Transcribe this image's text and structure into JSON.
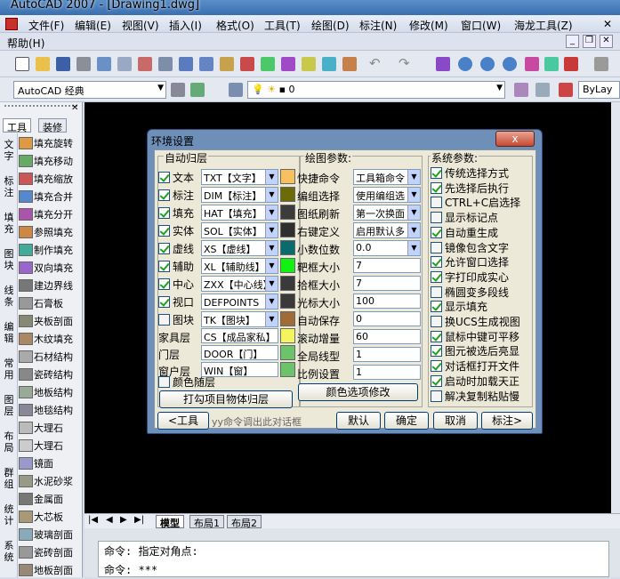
{
  "window": {
    "title_app": "AutoCAD 2007 - ",
    "title_doc": "[Drawing1.dwg]"
  },
  "menu": [
    "文件(F)",
    "编辑(E)",
    "视图(V)",
    "插入(I)",
    "格式(O)",
    "工具(T)",
    "绘图(D)",
    "标注(N)",
    "修改(M)",
    "窗口(W)",
    "海龙工具(Z)"
  ],
  "menu2": [
    "帮助(H)"
  ],
  "toolbar": {
    "workspace": "AutoCAD 经典",
    "layer_value": "0",
    "bylayer": "ByLay"
  },
  "palette": {
    "tabs": [
      "工具",
      "装修"
    ],
    "vtabs": [
      "文字",
      "标注",
      "填充",
      "图块",
      "线条",
      "编辑",
      "常用",
      "图层",
      "布局",
      "群组",
      "统计",
      "系统"
    ],
    "tools": [
      "填充旋转",
      "填充移动",
      "填充缩放",
      "填充合并",
      "填充分开",
      "参照填充",
      "制作填充",
      "双向填充",
      "建边界线",
      "石膏板",
      "夹板剖面",
      "木纹填充",
      "石材结构",
      "瓷砖结构",
      "地板结构",
      "地毯结构",
      "大理石",
      "大理石",
      "镜面",
      "水泥砂浆",
      "金属面",
      "大芯板",
      "玻璃剖面",
      "瓷砖剖面",
      "地板剖面"
    ]
  },
  "layout_tabs": [
    "模型",
    "布局1",
    "布局2"
  ],
  "command": {
    "line1": "命令: 指定对角点:",
    "line2": "命令: ***"
  },
  "dialog": {
    "title": "环境设置",
    "close": "x",
    "group_auto_layer": "自动归层",
    "auto_layers": [
      {
        "label": "文本",
        "checked": true,
        "select": "TXT【文字】",
        "color": "#f6c15e"
      },
      {
        "label": "标注",
        "checked": true,
        "select": "DIM【标注】",
        "color": "#6b6c08"
      },
      {
        "label": "填充",
        "checked": true,
        "select": "HAT【填充】",
        "color": "#3b3b3b"
      },
      {
        "label": "实体",
        "checked": true,
        "select": "SOL【实体】",
        "color": "#2f2f2f"
      },
      {
        "label": "虚线",
        "checked": true,
        "select": "XS【虚线】",
        "color": "#0a6b6e"
      },
      {
        "label": "辅助",
        "checked": true,
        "select": "XL【辅助线】",
        "color": "#12f212"
      },
      {
        "label": "中心",
        "checked": true,
        "select": "ZXX【中心线】",
        "color": "#3a3a3a"
      },
      {
        "label": "视口",
        "checked": true,
        "select": "DEFPOINTS【",
        "color": "#3a3a3a"
      },
      {
        "label": "图块",
        "checked": false,
        "select": "TK【图块】",
        "color": "#a06b36"
      }
    ],
    "plain_layers": [
      {
        "label": "家具层",
        "value": "CS【成品家私】",
        "color": "#f4f45e"
      },
      {
        "label": "门层",
        "value": "DOOR【门】",
        "color": "#6cc36c"
      },
      {
        "label": "窗户层",
        "value": "WIN【窗】",
        "color": "#6cc36c"
      }
    ],
    "color_follow": "颜色随层",
    "btn_assign": "打勾项目物体归层",
    "group_draw": "绘图参数:",
    "draw_params": [
      {
        "label": "快捷命令",
        "value": "工具箱命令",
        "type": "select"
      },
      {
        "label": "编组选择",
        "value": "使用编组选",
        "type": "select"
      },
      {
        "label": "图纸刷新",
        "value": "第一次换面",
        "type": "select"
      },
      {
        "label": "右键定义",
        "value": "启用默认多",
        "type": "select"
      },
      {
        "label": "小数位数",
        "value": "0.0",
        "type": "select"
      },
      {
        "label": "靶框大小",
        "value": "7",
        "type": "input"
      },
      {
        "label": "拾框大小",
        "value": "7",
        "type": "input"
      },
      {
        "label": "光标大小",
        "value": "100",
        "type": "input"
      },
      {
        "label": "自动保存",
        "value": "0",
        "type": "input"
      },
      {
        "label": "滚动增量",
        "value": "60",
        "type": "input"
      },
      {
        "label": "全局线型",
        "value": "1",
        "type": "input"
      },
      {
        "label": "比例设置",
        "value": "1",
        "type": "input"
      }
    ],
    "btn_color": "颜色选项修改",
    "group_system": "系统参数:",
    "system_params": [
      {
        "label": "传统选择方式",
        "checked": true
      },
      {
        "label": "先选择后执行",
        "checked": true
      },
      {
        "label": "CTRL+C启选择",
        "checked": false
      },
      {
        "label": "显示标记点",
        "checked": false
      },
      {
        "label": "自动重生成",
        "checked": true
      },
      {
        "label": "镜像包含文字",
        "checked": false
      },
      {
        "label": "允许窗口选择",
        "checked": true
      },
      {
        "label": "字打印成实心",
        "checked": true
      },
      {
        "label": "椭圆变多段线",
        "checked": false
      },
      {
        "label": "显示填充",
        "checked": true
      },
      {
        "label": "换UCS生成视图",
        "checked": false
      },
      {
        "label": "鼠标中键可平移",
        "checked": true
      },
      {
        "label": "图元被选后亮显",
        "checked": true
      },
      {
        "label": "对话框打开文件",
        "checked": true
      },
      {
        "label": "启动时加载天正",
        "checked": true
      },
      {
        "label": "解决复制粘贴慢",
        "checked": false
      }
    ],
    "btn_back": "<工具",
    "hint": "yy命令调出此对话框",
    "btn_default": "默认",
    "btn_ok": "确定",
    "btn_cancel": "取消",
    "btn_dim": "标注>"
  }
}
